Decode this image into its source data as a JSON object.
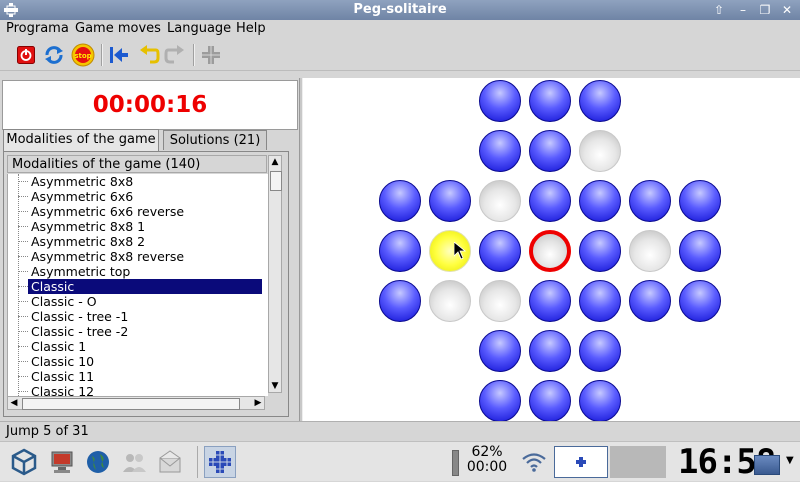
{
  "window": {
    "title": "Peg-solitaire",
    "buttons": [
      "up-arrow-icon",
      "minimize-icon",
      "restore-icon",
      "close-icon"
    ]
  },
  "menu": {
    "items": [
      "Programa",
      "Game moves",
      "Language",
      "Help"
    ]
  },
  "toolbar": {
    "icons": [
      "power-icon",
      "refresh-icon",
      "stop-icon",
      "back-to-start-icon",
      "undo-icon",
      "redo-icon",
      "board-icon"
    ],
    "stop_label": "stop"
  },
  "timer": {
    "value": "00:00:16"
  },
  "tabs": [
    {
      "label": "Modalities of the game"
    },
    {
      "label": "Solutions (21)"
    }
  ],
  "list": {
    "header": "Modalities of the game (140)",
    "items": [
      "Asymmetric  8x8",
      "Asymmetric 6x6",
      "Asymmetric 6x6 reverse",
      "Asymmetric 8x8 1",
      "Asymmetric 8x8 2",
      "Asymmetric 8x8 reverse",
      "Asymmetric top",
      "Classic",
      "Classic - O",
      "Classic - tree -1",
      "Classic - tree -2",
      "Classic 1",
      "Classic 10",
      "Classic 11",
      "Classic 12"
    ],
    "selected": "Classic"
  },
  "board": {
    "cells": [
      [
        "blue",
        "blue",
        "blue"
      ],
      [
        "blue",
        "blue",
        "empty"
      ],
      [
        "blue",
        "blue",
        "empty",
        "blue",
        "blue",
        "blue",
        "blue"
      ],
      [
        "blue",
        "yellow",
        "blue",
        "target",
        "blue",
        "empty",
        "blue"
      ],
      [
        "blue",
        "empty",
        "empty",
        "blue",
        "blue",
        "blue",
        "blue"
      ],
      [
        "blue",
        "blue",
        "blue"
      ],
      [
        "blue",
        "blue",
        "blue"
      ]
    ],
    "colors": {
      "peg": "#2a2aee",
      "selected": "#ffff40",
      "target_ring": "#ee0000",
      "empty": "#d0d0d0"
    }
  },
  "status": {
    "text": "Jump 5 of 31"
  },
  "taskbar": {
    "icons": [
      "cube-icon",
      "monitor-icon",
      "globe-icon",
      "users-icon",
      "mail-icon",
      "peg-solitaire-task-icon"
    ],
    "battery_percent": "62%",
    "battery_time": "00:00",
    "clock": "16:58",
    "tray_icons": [
      "battery-icon",
      "wifi-icon",
      "window-preview-icon",
      "desktop-icon",
      "menu-arrow-icon"
    ]
  }
}
